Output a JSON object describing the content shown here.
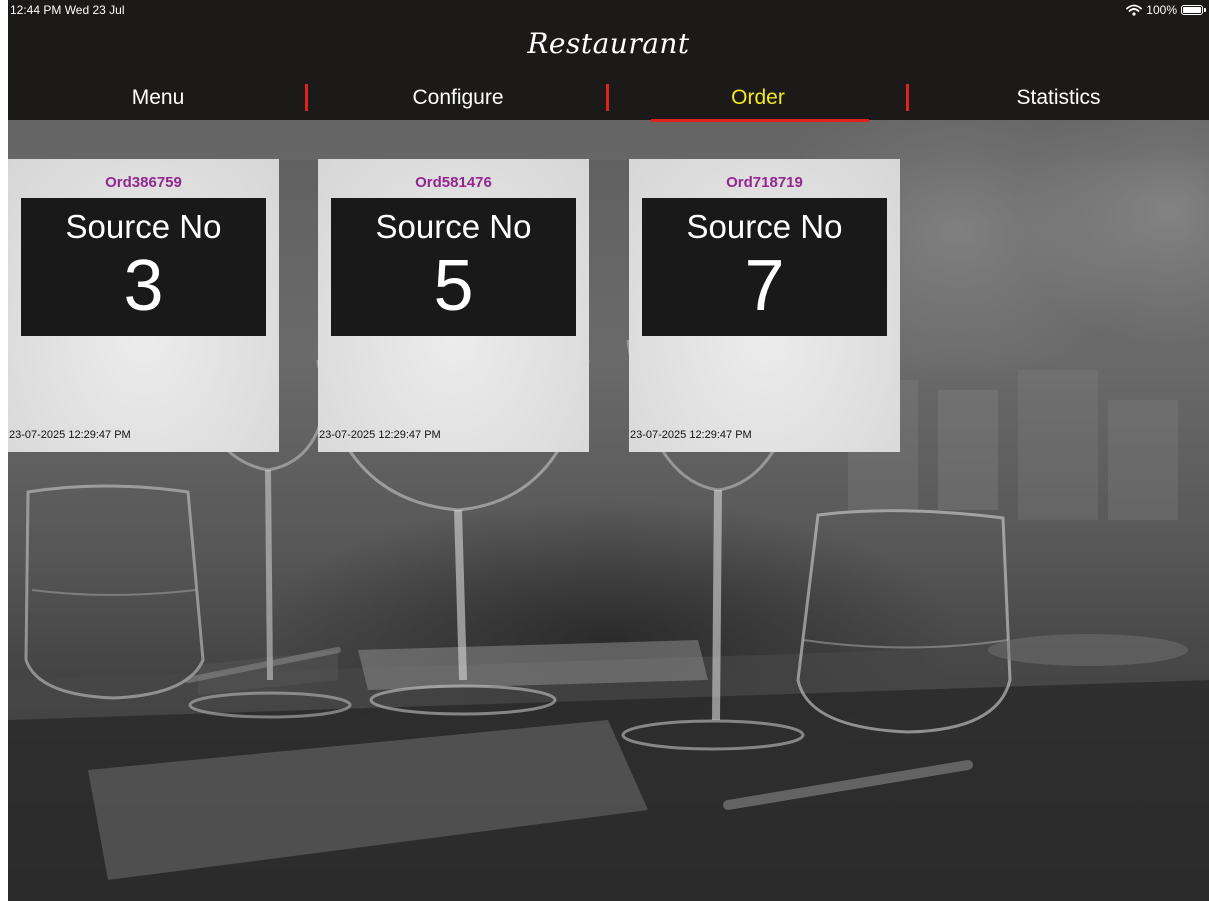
{
  "status_bar": {
    "time": "12:44 PM  Wed 23 Jul",
    "battery_text": "100%",
    "battery_level": 1.0,
    "wifi_icon": "wifi-icon",
    "battery_icon": "battery-icon"
  },
  "header": {
    "title": "Restaurant"
  },
  "tabs": [
    {
      "label": "Menu",
      "active": false
    },
    {
      "label": "Configure",
      "active": false
    },
    {
      "label": "Order",
      "active": true
    },
    {
      "label": "Statistics",
      "active": false
    }
  ],
  "colors": {
    "header_bg": "#1c1a19",
    "active_tab": "#f2e81f",
    "separator": "#e1221c",
    "order_id": "#93278f",
    "panel_bg": "#1a1919"
  },
  "orders": [
    {
      "id": "Ord386759",
      "label": "Source No",
      "number": "3",
      "timestamp": "23-07-2025 12:29:47 PM"
    },
    {
      "id": "Ord581476",
      "label": "Source No",
      "number": "5",
      "timestamp": "23-07-2025 12:29:47 PM"
    },
    {
      "id": "Ord718719",
      "label": "Source No",
      "number": "7",
      "timestamp": "23-07-2025 12:29:47 PM"
    }
  ]
}
